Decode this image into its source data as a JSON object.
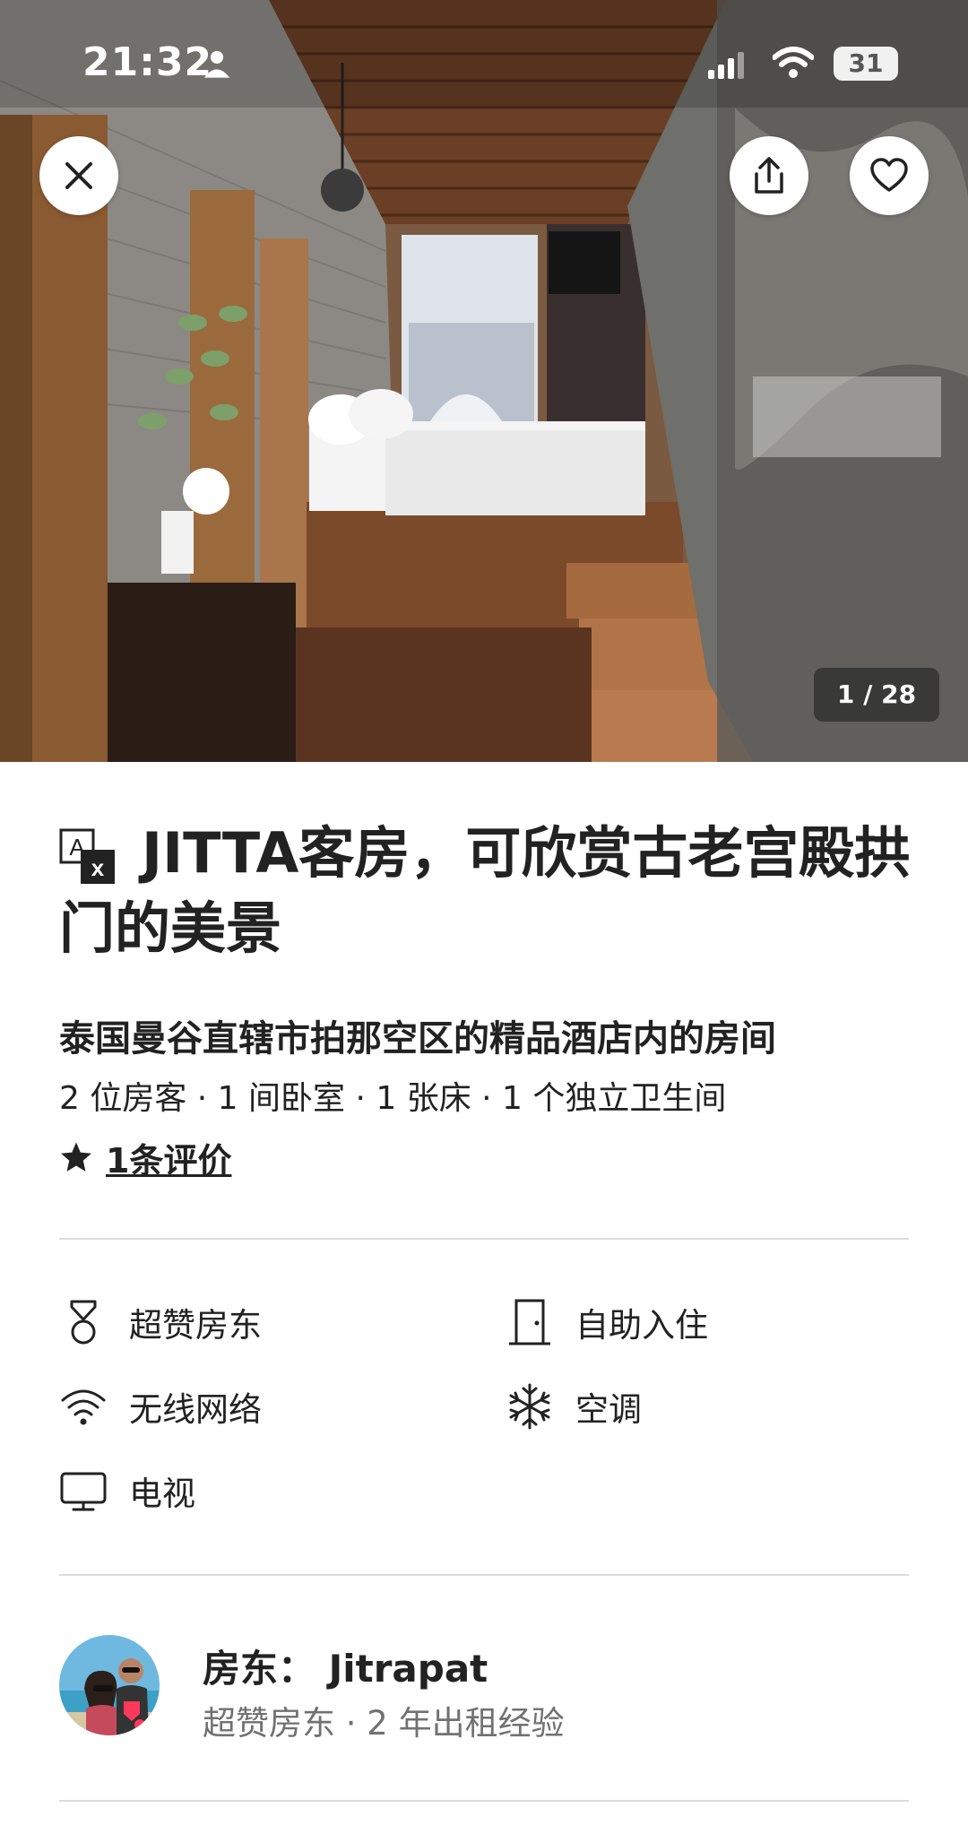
{
  "status_bar": {
    "time": "21:32",
    "battery": "31"
  },
  "hero": {
    "photo_counter": "1 / 28"
  },
  "listing": {
    "title": "JITTA客房，可欣赏古老宫殿拱门的美景",
    "subtitle": "泰国曼谷直辖市拍那空区的精品酒店内的房间",
    "specs": "2 位房客 · 1 间卧室 · 1 张床 · 1 个独立卫生间",
    "reviews_label": "1条评价"
  },
  "amenities": [
    {
      "label": "超赞房东",
      "icon": "medal-icon"
    },
    {
      "label": "自助入住",
      "icon": "door-icon"
    },
    {
      "label": "无线网络",
      "icon": "wifi-icon"
    },
    {
      "label": "空调",
      "icon": "snowflake-icon"
    },
    {
      "label": "电视",
      "icon": "tv-icon"
    }
  ],
  "host": {
    "name": "房东： Jitrapat",
    "info": "超赞房东 · 2 年出租经验"
  },
  "colors": {
    "text": "#222222",
    "muted": "#717171",
    "divider": "#dddddd",
    "accent": "#ff385c"
  }
}
